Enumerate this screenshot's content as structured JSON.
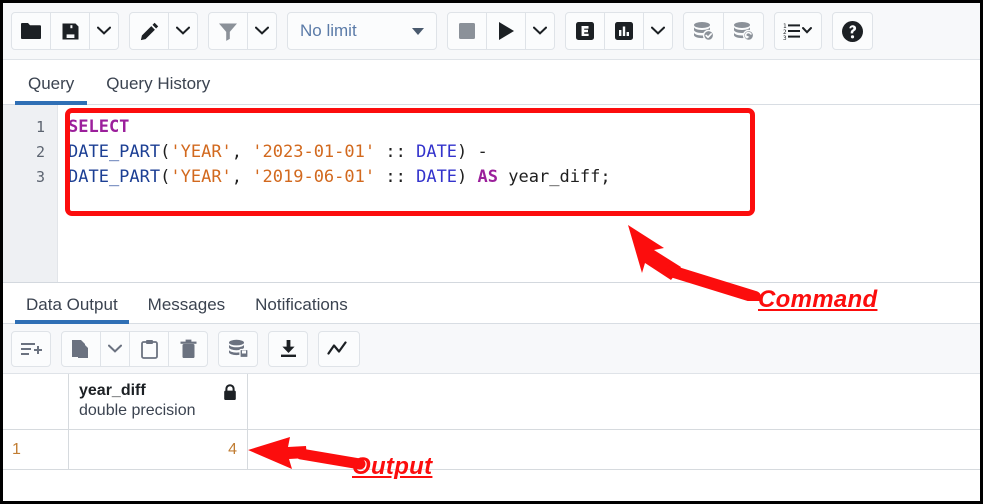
{
  "app": {
    "name": "pgAdmin Query Tool"
  },
  "toolbar": {
    "groups": [
      {
        "name": "file-group",
        "buttons": [
          {
            "name": "open-file-button",
            "icon": "folder-icon",
            "label": "Open File"
          },
          {
            "name": "save-file-button",
            "icon": "save-icon",
            "label": "Save File"
          },
          {
            "name": "save-file-dropdown",
            "icon": "chevron-down-icon",
            "label": "Save options"
          }
        ]
      },
      {
        "name": "edit-group",
        "buttons": [
          {
            "name": "edit-button",
            "icon": "pencil-icon",
            "label": "Edit"
          },
          {
            "name": "edit-dropdown",
            "icon": "chevron-down-icon",
            "label": "Edit options"
          }
        ]
      },
      {
        "name": "filter-group",
        "buttons": [
          {
            "name": "filter-button",
            "icon": "funnel-icon",
            "label": "Filter"
          },
          {
            "name": "filter-dropdown",
            "icon": "chevron-down-icon",
            "label": "Filter options"
          }
        ]
      },
      {
        "name": "execute-group",
        "buttons": [
          {
            "name": "stop-button",
            "icon": "stop-square-icon",
            "label": "Stop"
          },
          {
            "name": "execute-button",
            "icon": "play-triangle-icon",
            "label": "Execute"
          },
          {
            "name": "execute-dropdown",
            "icon": "chevron-down-icon",
            "label": "Execute options"
          }
        ]
      },
      {
        "name": "explain-group",
        "buttons": [
          {
            "name": "explain-button",
            "icon": "explain-e-icon",
            "label": "Explain"
          },
          {
            "name": "explain-analyze-button",
            "icon": "explain-chart-icon",
            "label": "Explain Analyze"
          },
          {
            "name": "explain-dropdown",
            "icon": "chevron-down-icon",
            "label": "Explain options"
          }
        ]
      },
      {
        "name": "transaction-group",
        "buttons": [
          {
            "name": "commit-button",
            "icon": "database-check-icon",
            "label": "Commit"
          },
          {
            "name": "rollback-button",
            "icon": "database-rollback-icon",
            "label": "Rollback"
          }
        ]
      },
      {
        "name": "macros-group",
        "buttons": [
          {
            "name": "macros-button",
            "icon": "list-numbered-icon",
            "label": "Macros"
          }
        ]
      },
      {
        "name": "help-group",
        "buttons": [
          {
            "name": "help-button",
            "icon": "question-circle-icon",
            "label": "Help"
          }
        ]
      }
    ],
    "row_limit": {
      "value": "No limit",
      "name": "row-limit-select"
    }
  },
  "query_tabs": [
    {
      "label": "Query",
      "active": true
    },
    {
      "label": "Query History",
      "active": false
    }
  ],
  "editor": {
    "line_numbers": [
      "1",
      "2",
      "3"
    ],
    "lines": [
      [
        {
          "t": "SELECT",
          "c": "keyword"
        }
      ],
      [
        {
          "t": "DATE_PART",
          "c": "func"
        },
        {
          "t": "(",
          "c": "op"
        },
        {
          "t": "'YEAR'",
          "c": "string"
        },
        {
          "t": ", ",
          "c": "op"
        },
        {
          "t": "'2023-01-01'",
          "c": "string"
        },
        {
          "t": " ",
          "c": "op"
        },
        {
          "t": "::",
          "c": "op"
        },
        {
          "t": " ",
          "c": "op"
        },
        {
          "t": "DATE",
          "c": "type"
        },
        {
          "t": ")",
          "c": "op"
        },
        {
          "t": " ",
          "c": "op"
        },
        {
          "t": "-",
          "c": "op"
        }
      ],
      [
        {
          "t": "DATE_PART",
          "c": "func"
        },
        {
          "t": "(",
          "c": "op"
        },
        {
          "t": "'YEAR'",
          "c": "string"
        },
        {
          "t": ", ",
          "c": "op"
        },
        {
          "t": "'2019-06-01'",
          "c": "string"
        },
        {
          "t": " ",
          "c": "op"
        },
        {
          "t": "::",
          "c": "op"
        },
        {
          "t": " ",
          "c": "op"
        },
        {
          "t": "DATE",
          "c": "type"
        },
        {
          "t": ")",
          "c": "op"
        },
        {
          "t": " ",
          "c": "op"
        },
        {
          "t": "AS",
          "c": "keyword"
        },
        {
          "t": " ",
          "c": "op"
        },
        {
          "t": "year_diff",
          "c": "ident"
        },
        {
          "t": ";",
          "c": "op"
        }
      ]
    ],
    "plain_text": "SELECT\nDATE_PART('YEAR', '2023-01-01' :: DATE) -\nDATE_PART('YEAR', '2019-06-01' :: DATE) AS year_diff;"
  },
  "output_tabs": [
    {
      "label": "Data Output",
      "active": true
    },
    {
      "label": "Messages",
      "active": false
    },
    {
      "label": "Notifications",
      "active": false
    }
  ],
  "results_toolbar": {
    "groups": [
      {
        "name": "add-row-group",
        "buttons": [
          {
            "name": "add-row-button",
            "icon": "add-row-icon",
            "label": "Add row"
          }
        ]
      },
      {
        "name": "clipboard-group",
        "buttons": [
          {
            "name": "copy-button",
            "icon": "copy-icon",
            "label": "Copy"
          },
          {
            "name": "copy-dropdown",
            "icon": "chevron-down-icon",
            "label": "Copy options"
          },
          {
            "name": "paste-button",
            "icon": "clipboard-icon",
            "label": "Paste"
          },
          {
            "name": "delete-button",
            "icon": "trash-icon",
            "label": "Delete"
          }
        ]
      },
      {
        "name": "save-data-group",
        "buttons": [
          {
            "name": "save-data-button",
            "icon": "database-save-icon",
            "label": "Save Data Changes"
          }
        ]
      },
      {
        "name": "download-group",
        "buttons": [
          {
            "name": "download-button",
            "icon": "download-icon",
            "label": "Download as CSV"
          }
        ]
      },
      {
        "name": "graph-group",
        "buttons": [
          {
            "name": "graph-visualiser-button",
            "icon": "graph-line-icon",
            "label": "Graph Visualiser"
          }
        ]
      }
    ]
  },
  "result_grid": {
    "columns": [
      {
        "name": "year_diff",
        "type": "double precision",
        "readonly_icon": "lock-icon"
      }
    ],
    "rows": [
      {
        "number": "1",
        "cells": [
          "4"
        ]
      }
    ]
  },
  "annotations": [
    {
      "name": "command-annotation",
      "label": "Command",
      "color": "#fc0d0d"
    },
    {
      "name": "output-annotation",
      "label": "Output",
      "color": "#fc0d0d"
    }
  ]
}
